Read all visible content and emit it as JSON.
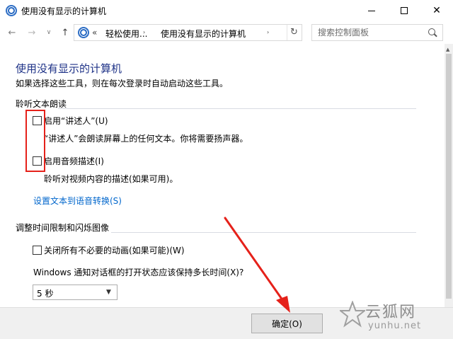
{
  "window": {
    "title": "使用没有显示的计算机"
  },
  "nav": {
    "back_glyph": "←",
    "forward_glyph": "→",
    "dropdown_glyph": "∨",
    "up_glyph": "↑"
  },
  "address": {
    "ellipsis": "«",
    "breadcrumbs": [
      "轻松使用...",
      "使用没有显示的计算机"
    ],
    "separator": "›",
    "refresh_glyph": "↻"
  },
  "search": {
    "placeholder": "搜索控制面板"
  },
  "main": {
    "title": "使用没有显示的计算机",
    "description": "如果选择这些工具，则在每次登录时自动启动这些工具。",
    "sections": [
      {
        "header": "聆听文本朗读",
        "options": [
          {
            "label": "启用“讲述人”(U)",
            "description": "“讲述人”会朗读屏幕上的任何文本。你将需要扬声器。",
            "checked": false
          },
          {
            "label": "启用音频描述(I)",
            "description": "聆听对视频内容的描述(如果可用)。",
            "checked": false
          }
        ],
        "link": "设置文本到语音转换(S)"
      },
      {
        "header": "调整时间限制和闪烁图像",
        "options": [
          {
            "label": "关闭所有不必要的动画(如果可能)(W)",
            "checked": false
          }
        ],
        "question": "Windows 通知对话框的打开状态应该保持多长时间(X)?",
        "select": {
          "value": "5 秒"
        }
      }
    ]
  },
  "footer": {
    "ok_label": "确定(O)"
  },
  "watermark": {
    "text": "云狐网",
    "sub": "yunhu.net"
  },
  "colors": {
    "title_blue": "#1e3287",
    "link_blue": "#0066cc",
    "annotation_red": "#e5211a"
  }
}
